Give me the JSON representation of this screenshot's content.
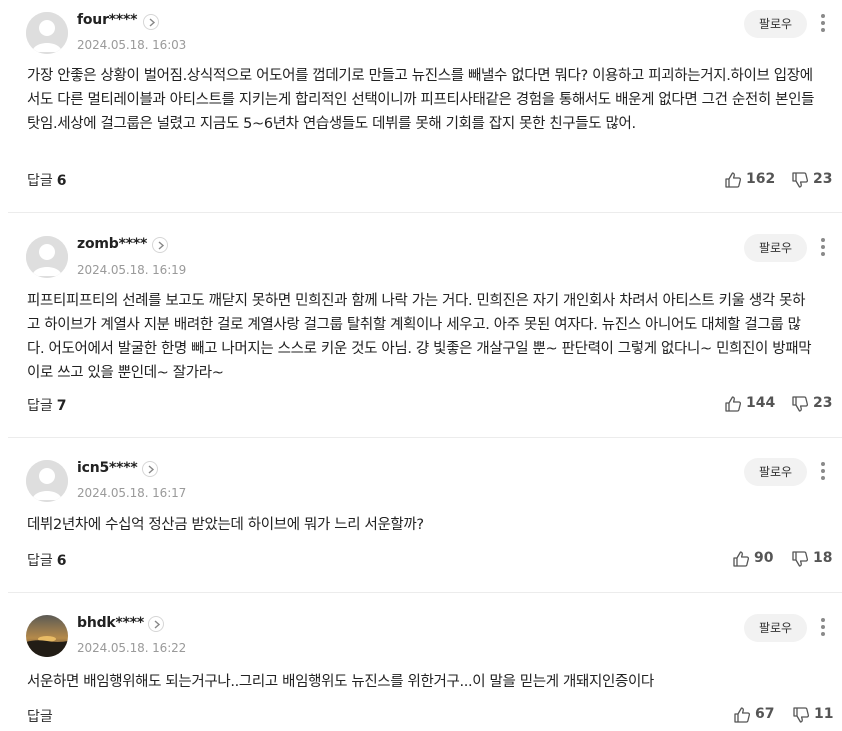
{
  "comments": [
    {
      "username": "four****",
      "date": "2024.05.18. 16:03",
      "follow_label": "팔로우",
      "text": "가장 안좋은 상황이 벌어짐.상식적으로 어도어를 껍데기로 만들고 뉴진스를 빼낼수 없다면 뭐다? 이용하고 피괴하는거지.하이브 입장에서도 다른 멀티레이블과 아티스트를 지키는게 합리적인 선택이니까 피프티사태같은 경험을 통해서도 배운게 없다면 그건 순전히 본인들탓임.세상에 걸그룹은 널렸고 지금도 5~6년차 연습생들도 데뷔를 못해 기회를 잡지 못한 친구들도 많어.",
      "reply_label": "답글",
      "reply_count": "6",
      "likes": "162",
      "dislikes": "23",
      "avatar": "default"
    },
    {
      "username": "zomb****",
      "date": "2024.05.18. 16:19",
      "follow_label": "팔로우",
      "text": "피프티피프티의 선례를 보고도 깨닫지 못하면 민희진과 함께 나락 가는 거다. 민희진은 자기 개인회사 차려서 아티스트 키울 생각 못하고 하이브가 계열사 지분 배려한 걸로 계열사랑 걸그룹 탈취할 계획이나 세우고. 아주 못된 여자다. 뉴진스 아니어도 대체할 걸그룹 많다. 어도어에서 발굴한 한명 빼고 나머지는 스스로 키운 것도 아님. 걍 빛좋은 개살구일 뿐~ 판단력이 그렇게 없다니~ 민희진이 방패막이로 쓰고 있을 뿐인데~ 잘가라~",
      "reply_label": "답글",
      "reply_count": "7",
      "likes": "144",
      "dislikes": "23",
      "avatar": "default"
    },
    {
      "username": "icn5****",
      "date": "2024.05.18. 16:17",
      "follow_label": "팔로우",
      "text": "데뷔2년차에 수십억 정산금 받았는데 하이브에 뭐가 느리 서운할까?",
      "reply_label": "답글",
      "reply_count": "6",
      "likes": "90",
      "dislikes": "18",
      "avatar": "default"
    },
    {
      "username": "bhdk****",
      "date": "2024.05.18. 16:22",
      "follow_label": "팔로우",
      "text": "서운하면 배임행위해도 되는거구나..그리고 배임행위도 뉴진스를 위한거구...이 말을 믿는게 개돼지인증이다",
      "reply_label": "답글",
      "reply_count": "",
      "likes": "67",
      "dislikes": "11",
      "avatar": "sunset"
    }
  ]
}
